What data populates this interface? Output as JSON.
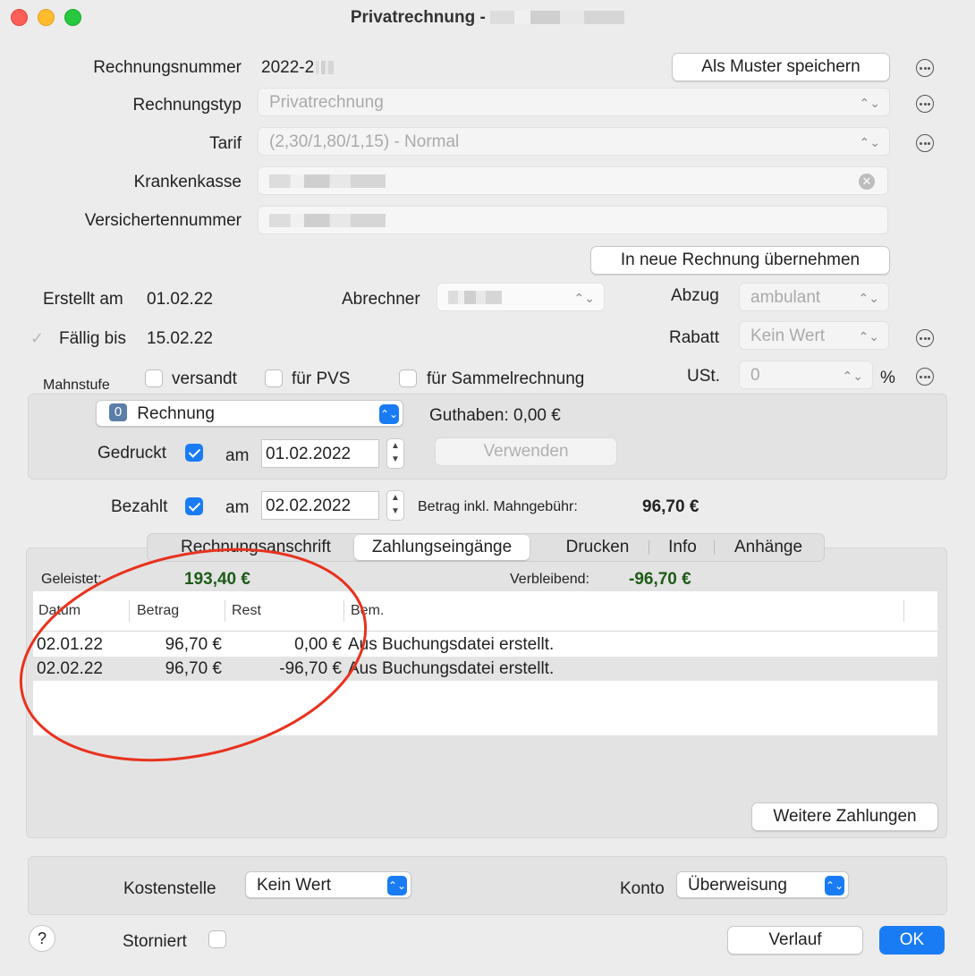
{
  "window": {
    "title_prefix": "Privatrechnung -"
  },
  "header": {
    "rechnungsnummer_label": "Rechnungsnummer",
    "rechnungsnummer_value": "2022-2",
    "als_muster_button": "Als Muster speichern",
    "rechnungstyp_label": "Rechnungstyp",
    "rechnungstyp_value": "Privatrechnung",
    "tarif_label": "Tarif",
    "tarif_value": "(2,30/1,80/1,15) - Normal",
    "krankenkasse_label": "Krankenkasse",
    "versichertennummer_label": "Versichertennummer",
    "neue_rechnung_button": "In neue Rechnung übernehmen"
  },
  "details": {
    "erstellt_label": "Erstellt am",
    "erstellt_value": "01.02.22",
    "faellig_label": "Fällig bis",
    "faellig_value": "15.02.22",
    "abrechner_label": "Abrechner",
    "abzug_label": "Abzug",
    "abzug_value": "ambulant",
    "rabatt_label": "Rabatt",
    "rabatt_value": "Kein Wert",
    "ust_label": "USt.",
    "ust_value": "0",
    "ust_unit": "%",
    "mahnstufe_label": "Mahnstufe",
    "versandt_label": "versandt",
    "pvs_label": "für PVS",
    "sammel_label": "für Sammelrechnung"
  },
  "status": {
    "status_number": "0",
    "status_value": "Rechnung",
    "guthaben_label": "Guthaben: 0,00 €",
    "gedruckt_label": "Gedruckt",
    "am_label": "am",
    "gedruckt_date": "01.02.2022",
    "verwenden_button": "Verwenden",
    "bezahlt_label": "Bezahlt",
    "bezahlt_date": "02.02.2022",
    "betrag_label": "Betrag inkl. Mahngebühr:",
    "betrag_value": "96,70 €"
  },
  "tabs": [
    "Rechnungsanschrift",
    "Zahlungseingänge",
    "Drucken",
    "Info",
    "Anhänge"
  ],
  "payments": {
    "geleistet_label": "Geleistet:",
    "geleistet_value": "193,40 €",
    "verbleibend_label": "Verbleibend:",
    "verbleibend_value": "-96,70 €",
    "columns": [
      "Datum",
      "Betrag",
      "Rest",
      "Bem."
    ],
    "rows": [
      {
        "datum": "02.01.22",
        "betrag": "96,70 €",
        "rest": "0,00 €",
        "bem": "Aus Buchungsdatei erstellt."
      },
      {
        "datum": "02.02.22",
        "betrag": "96,70 €",
        "rest": "-96,70 €",
        "bem": "Aus Buchungsdatei erstellt."
      }
    ],
    "weitere_button": "Weitere Zahlungen"
  },
  "footer": {
    "kostenstelle_label": "Kostenstelle",
    "kostenstelle_value": "Kein Wert",
    "konto_label": "Konto",
    "konto_value": "Überweisung",
    "storniert_label": "Storniert",
    "help_label": "?",
    "verlauf_button": "Verlauf",
    "ok_button": "OK"
  },
  "colors": {
    "accent": "#1a7cf5",
    "positive_green": "#1d5c16",
    "annotation_red": "#e8321e"
  }
}
